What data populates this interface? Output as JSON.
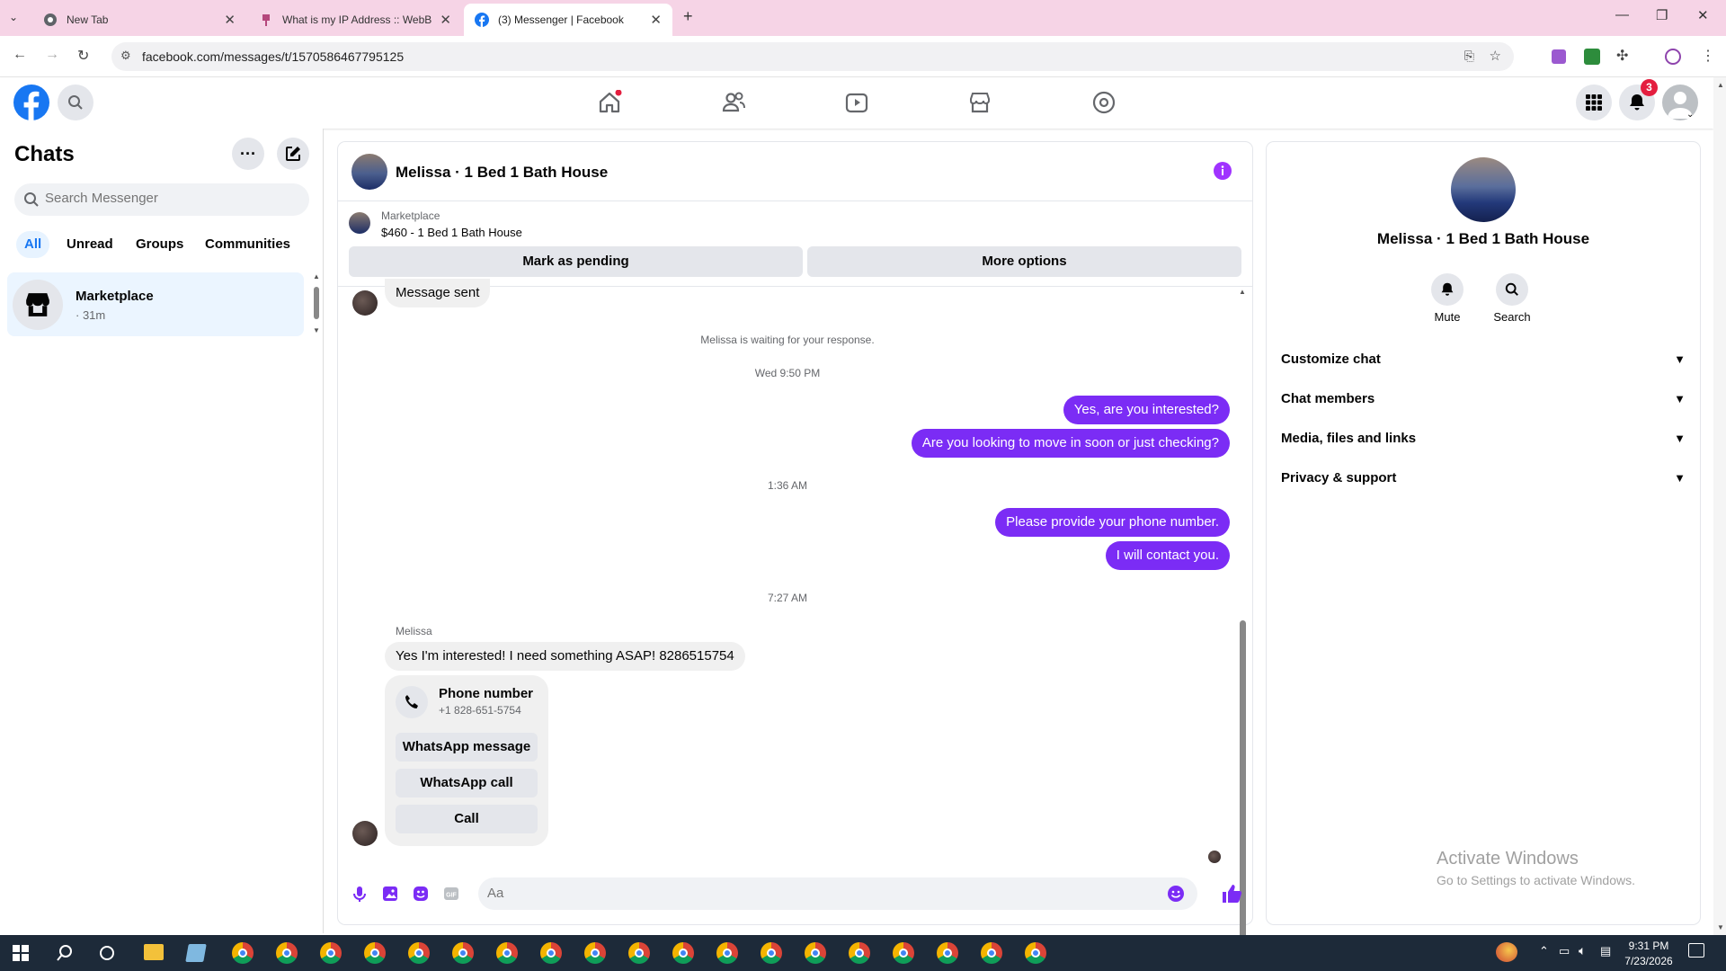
{
  "browser": {
    "tabs": [
      {
        "title": "New Tab",
        "active": false
      },
      {
        "title": "What is my IP Address :: WebBr",
        "active": false
      },
      {
        "title": "(3) Messenger | Facebook",
        "active": true
      }
    ],
    "url": "facebook.com/messages/t/1570586467795125"
  },
  "fb_header": {
    "notifications_badge": "3",
    "nav": [
      "home-icon",
      "friends-icon",
      "watch-icon",
      "marketplace-icon",
      "gaming-icon"
    ]
  },
  "sidebar": {
    "title": "Chats",
    "search_placeholder": "Search Messenger",
    "filters": [
      "All",
      "Unread",
      "Groups",
      "Communities"
    ],
    "active_filter": "All",
    "chats": [
      {
        "name": "Marketplace",
        "meta": "· 31m"
      }
    ]
  },
  "conversation": {
    "title": "Melissa · 1 Bed 1 Bath House",
    "listing": {
      "label": "Marketplace",
      "detail": "$460 - 1 Bed 1 Bath House"
    },
    "actions": {
      "pending": "Mark as pending",
      "more": "More options"
    },
    "messages": {
      "sent_note": "Message sent",
      "waiting": "Melissa is waiting for your response.",
      "time1": "Wed 9:50 PM",
      "out1": "Yes, are you interested?",
      "out2": "Are you looking to move in soon or just checking?",
      "time2": "1:36 AM",
      "out3": "Please provide your phone number.",
      "out4": "I will contact you.",
      "time3": "7:27 AM",
      "sender": "Melissa",
      "in1": "Yes I'm interested!  I need something ASAP! 8286515754",
      "card": {
        "title": "Phone number",
        "number": "+1 828-651-5754",
        "btn1": "WhatsApp message",
        "btn2": "WhatsApp call",
        "btn3": "Call"
      }
    },
    "composer_placeholder": "Aa"
  },
  "details": {
    "name": "Melissa · 1 Bed 1 Bath House",
    "actions": [
      "Mute",
      "Search"
    ],
    "sections": [
      "Customize chat",
      "Chat members",
      "Media, files and links",
      "Privacy & support"
    ],
    "watermark_title": "Activate Windows",
    "watermark_sub": "Go to Settings to activate Windows."
  },
  "taskbar": {
    "time": "9:31 PM",
    "date": "7/23/2026"
  },
  "colors": {
    "fb_blue": "#1877f2",
    "message_purple": "#7b2cf5",
    "tabstrip": "#f6d4e6"
  }
}
